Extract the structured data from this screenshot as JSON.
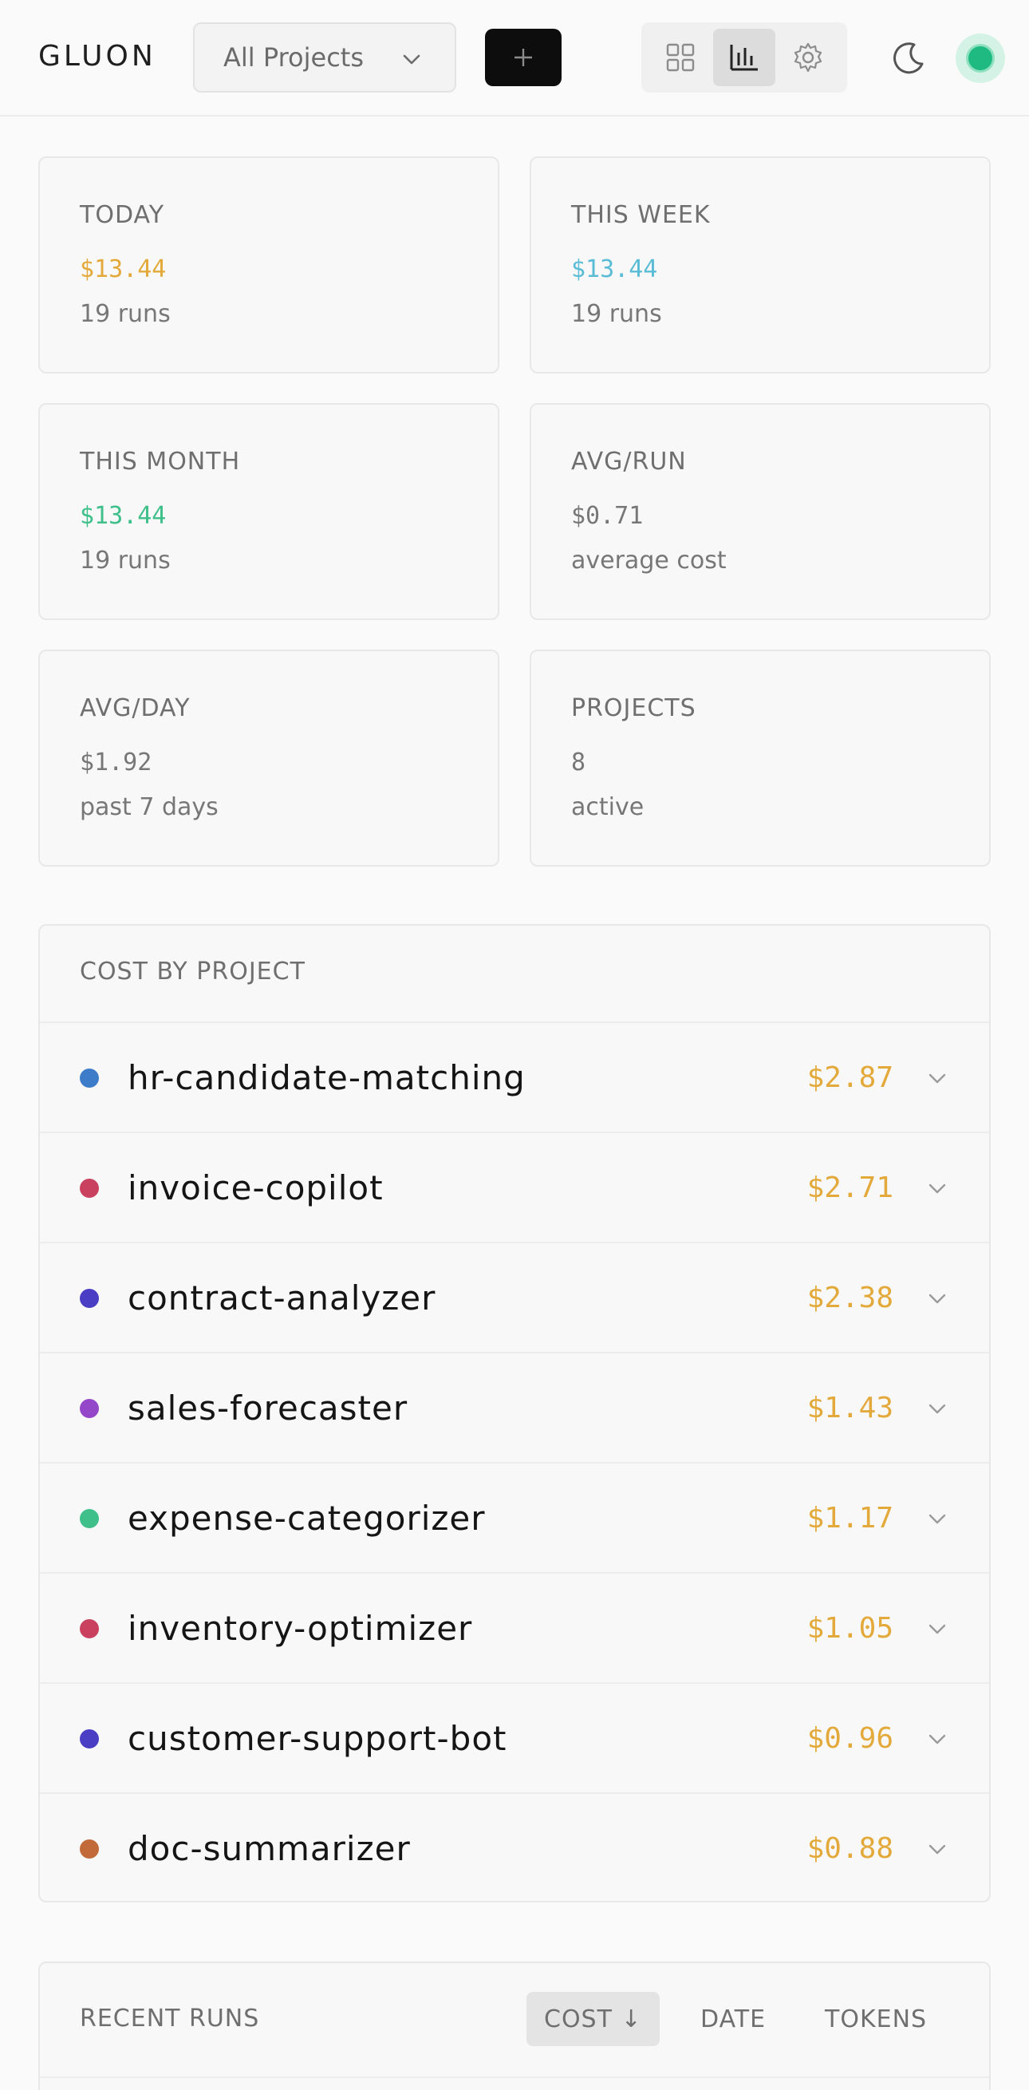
{
  "header": {
    "logo": "GLUON",
    "project_selector": "All Projects",
    "add_label": "+",
    "status_color": "#1fba82"
  },
  "stats": [
    {
      "label": "TODAY",
      "value": "$13.44",
      "sub": "19 runs",
      "color": "#e3a93a"
    },
    {
      "label": "THIS WEEK",
      "value": "$13.44",
      "sub": "19 runs",
      "color": "#5bbcd6"
    },
    {
      "label": "THIS MONTH",
      "value": "$13.44",
      "sub": "19 runs",
      "color": "#3fbf8a"
    },
    {
      "label": "AVG/RUN",
      "value": "$0.71",
      "sub": "average cost",
      "color": "#777777"
    },
    {
      "label": "AVG/DAY",
      "value": "$1.92",
      "sub": "past 7 days",
      "color": "#777777"
    },
    {
      "label": "PROJECTS",
      "value": "8",
      "sub": "active",
      "color": "#777777"
    }
  ],
  "cost_by_project": {
    "title": "COST BY PROJECT",
    "items": [
      {
        "name": "hr-candidate-matching",
        "cost": "$2.87",
        "color": "#3d7cc9"
      },
      {
        "name": "invoice-copilot",
        "cost": "$2.71",
        "color": "#c9415e"
      },
      {
        "name": "contract-analyzer",
        "cost": "$2.38",
        "color": "#4a3fc4"
      },
      {
        "name": "sales-forecaster",
        "cost": "$1.43",
        "color": "#9448c9"
      },
      {
        "name": "expense-categorizer",
        "cost": "$1.17",
        "color": "#3fbf8a"
      },
      {
        "name": "inventory-optimizer",
        "cost": "$1.05",
        "color": "#c9415e"
      },
      {
        "name": "customer-support-bot",
        "cost": "$0.96",
        "color": "#4a3fc4"
      },
      {
        "name": "doc-summarizer",
        "cost": "$0.88",
        "color": "#c26a3a"
      }
    ]
  },
  "recent_runs": {
    "title": "RECENT RUNS",
    "sort_options": [
      "COST ↓",
      "DATE",
      "TOKENS"
    ]
  }
}
